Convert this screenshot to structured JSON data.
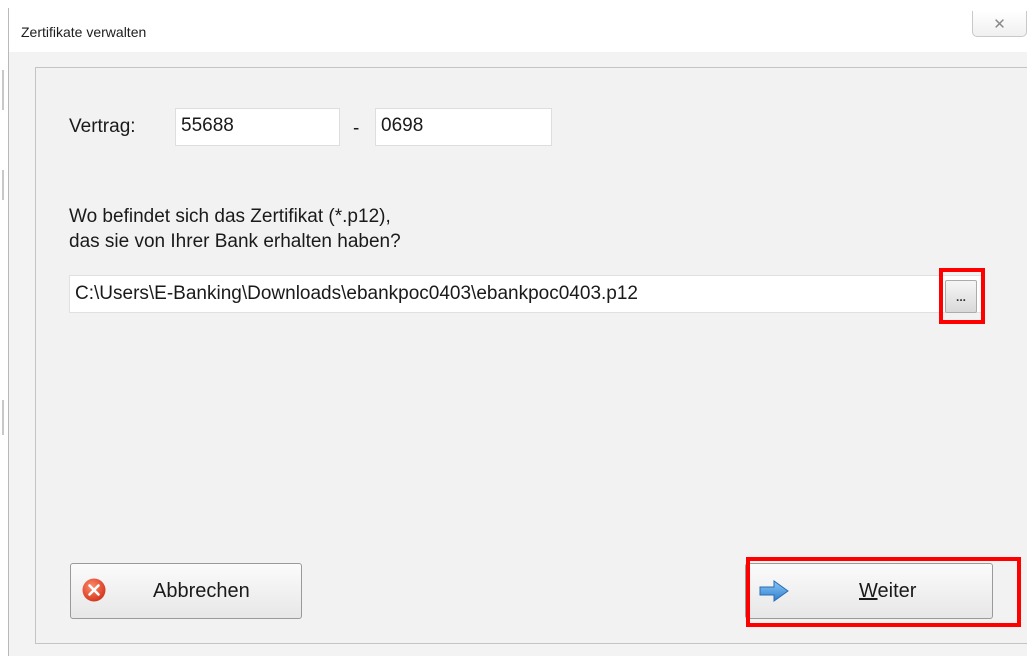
{
  "window": {
    "title": "Zertifikate verwalten"
  },
  "form": {
    "contract_label": "Vertrag:",
    "contract_number": "55688",
    "separator": "-",
    "contract_suffix": "0698",
    "question_line1": "Wo befindet sich das Zertifikat (*.p12),",
    "question_line2": "das sie von Ihrer Bank erhalten haben?",
    "certificate_path": "C:\\Users\\E-Banking\\Downloads\\ebankpoc0403\\ebankpoc0403.p12",
    "browse_label": "..."
  },
  "buttons": {
    "cancel_label": "Abbrechen",
    "next_label_prefix": "W",
    "next_label_rest": "eiter"
  },
  "icons": {
    "close": "close-icon",
    "cancel": "cancel-x-icon",
    "next": "arrow-right-icon"
  },
  "colors": {
    "highlight": "#ff0000",
    "arrow": "#3d8fd6",
    "cancel_icon": "#e0391e"
  }
}
